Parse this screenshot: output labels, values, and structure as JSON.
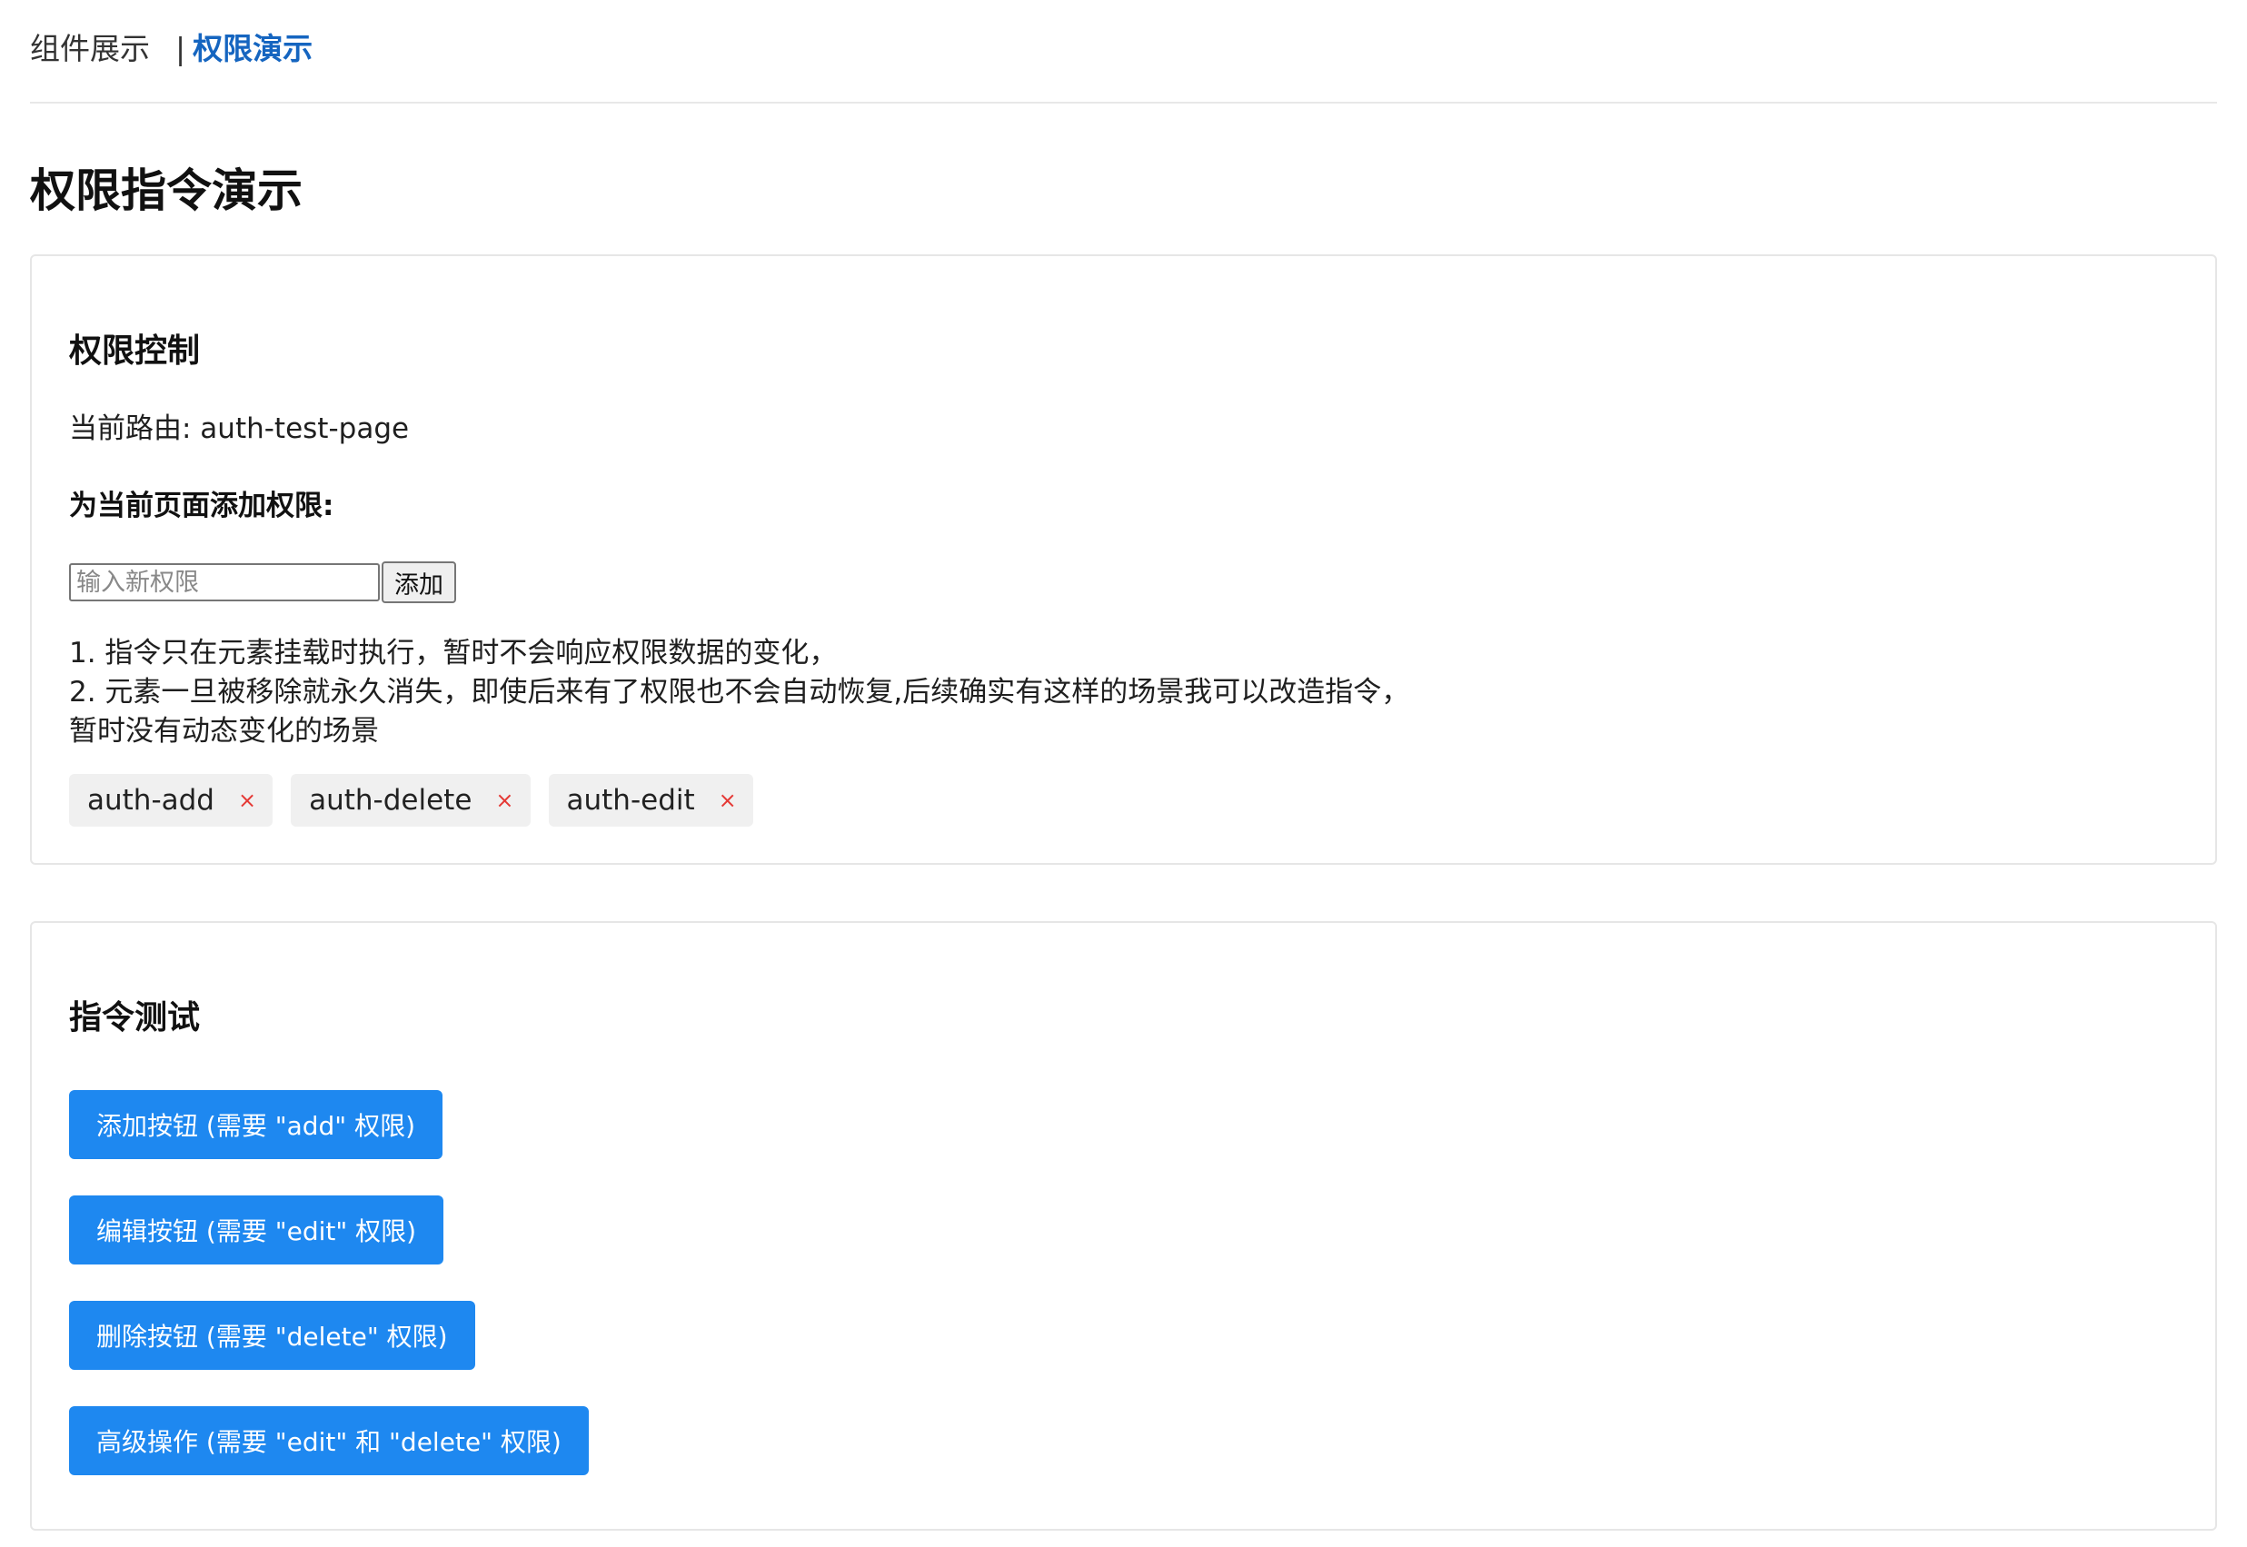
{
  "nav": {
    "items": [
      {
        "label": "组件展示",
        "active": false
      },
      {
        "label": "权限演示",
        "active": true
      }
    ],
    "separator": "|"
  },
  "page_title": "权限指令演示",
  "permission_card": {
    "title": "权限控制",
    "route_label": "当前路由: auth-test-page",
    "add_title": "为当前页面添加权限:",
    "input_placeholder": "输入新权限",
    "input_value": "",
    "add_button": "添加",
    "notes": [
      "1. 指令只在元素挂载时执行，暂时不会响应权限数据的变化，",
      "2. 元素一旦被移除就永久消失，即使后来有了权限也不会自动恢复,后续确实有这样的场景我可以改造指令，",
      "暂时没有动态变化的场景"
    ],
    "tags": [
      {
        "label": "auth-add",
        "close": "×"
      },
      {
        "label": "auth-delete",
        "close": "×"
      },
      {
        "label": "auth-edit",
        "close": "×"
      }
    ]
  },
  "test_card": {
    "title": "指令测试",
    "buttons": [
      "添加按钮 (需要 \"add\" 权限)",
      "编辑按钮 (需要 \"edit\" 权限)",
      "删除按钮 (需要 \"delete\" 权限)",
      "高级操作 (需要 \"edit\" 和 \"delete\" 权限)"
    ]
  },
  "colors": {
    "active_nav": "#1565c0",
    "primary_button": "#1e88f0",
    "tag_close": "#e53935"
  }
}
